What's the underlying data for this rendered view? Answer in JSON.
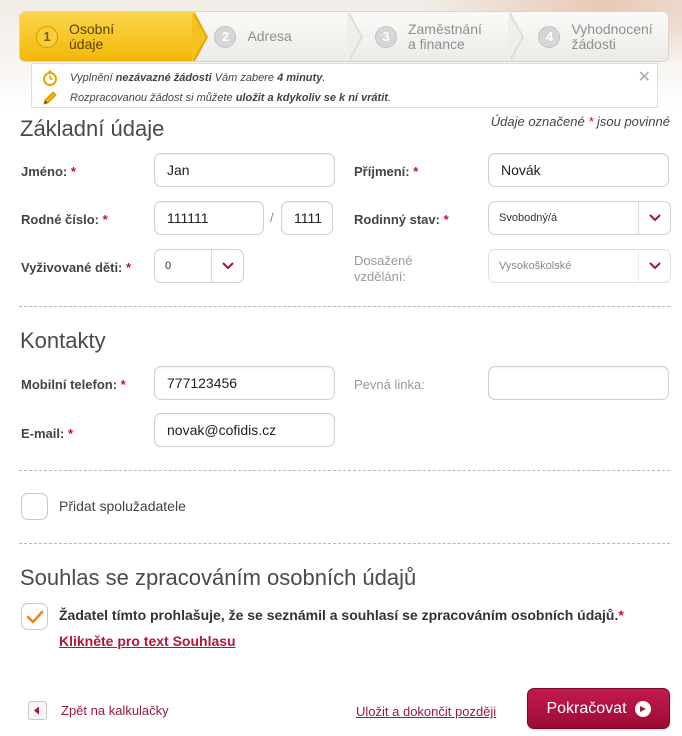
{
  "steps": [
    {
      "number": "1",
      "label": "Osobní\núdaje",
      "active": true
    },
    {
      "number": "2",
      "label": "Adresa",
      "active": false
    },
    {
      "number": "3",
      "label": "Zaměstnání\na finance",
      "active": false
    },
    {
      "number": "4",
      "label": "Vyhodnocení\nžádosti",
      "active": false
    }
  ],
  "info": {
    "line1_pre": "Vyplnění ",
    "line1_bold1": "nezávazné žádosti",
    "line1_mid": " Vám zabere ",
    "line1_bold2": "4 minuty",
    "line1_post": ".",
    "line2_pre": "Rozpracovanou žádost si můžete ",
    "line2_bold": "uložit a kdykoliv se k ní vrátit",
    "line2_post": ".",
    "close": "✕"
  },
  "basic": {
    "title": "Základní údaje",
    "required_note_pre": "Údaje označené ",
    "required_star": "*",
    "required_note_post": " jsou povinné",
    "first_name_label": "Jméno:",
    "first_name_value": "Jan",
    "last_name_label": "Příjmení:",
    "last_name_value": "Novák",
    "birth_number_label": "Rodné číslo:",
    "birth_number_part1": "111111",
    "birth_number_sep": "/",
    "birth_number_part2": "1111",
    "marital_label": "Rodinný stav:",
    "marital_value": "Svobodný/á",
    "children_label": "Vyživované děti:",
    "children_value": "0",
    "education_label_line1": "Dosažené",
    "education_label_line2": "vzdělání:",
    "education_value": "Vysokoškolské",
    "star": "*"
  },
  "contacts": {
    "title": "Kontakty",
    "mobile_label": "Mobilní telefon:",
    "mobile_value": "777123456",
    "landline_label": "Pevná linka:",
    "landline_value": "",
    "email_label": "E-mail:",
    "email_value": "novak@cofidis.cz"
  },
  "coapplicant": {
    "label": "Přidat spolužadatele",
    "checked": false
  },
  "consent": {
    "title": "Souhlas se zpracováním osobních údajů",
    "text": "Žadatel tímto prohlašuje, že se seznámil a souhlasí se zpracováním osobních údajů.",
    "star": "*",
    "link": "Klikněte pro text Souhlasu",
    "checked": true
  },
  "footer": {
    "back_label": "Zpět na kalkulačky",
    "save_label": "Uložit a dokončit později",
    "continue_label": "Pokračovat"
  },
  "colors": {
    "brand": "#b0173c",
    "active_step": "#f2b707",
    "checkmark": "#e88a1a"
  }
}
